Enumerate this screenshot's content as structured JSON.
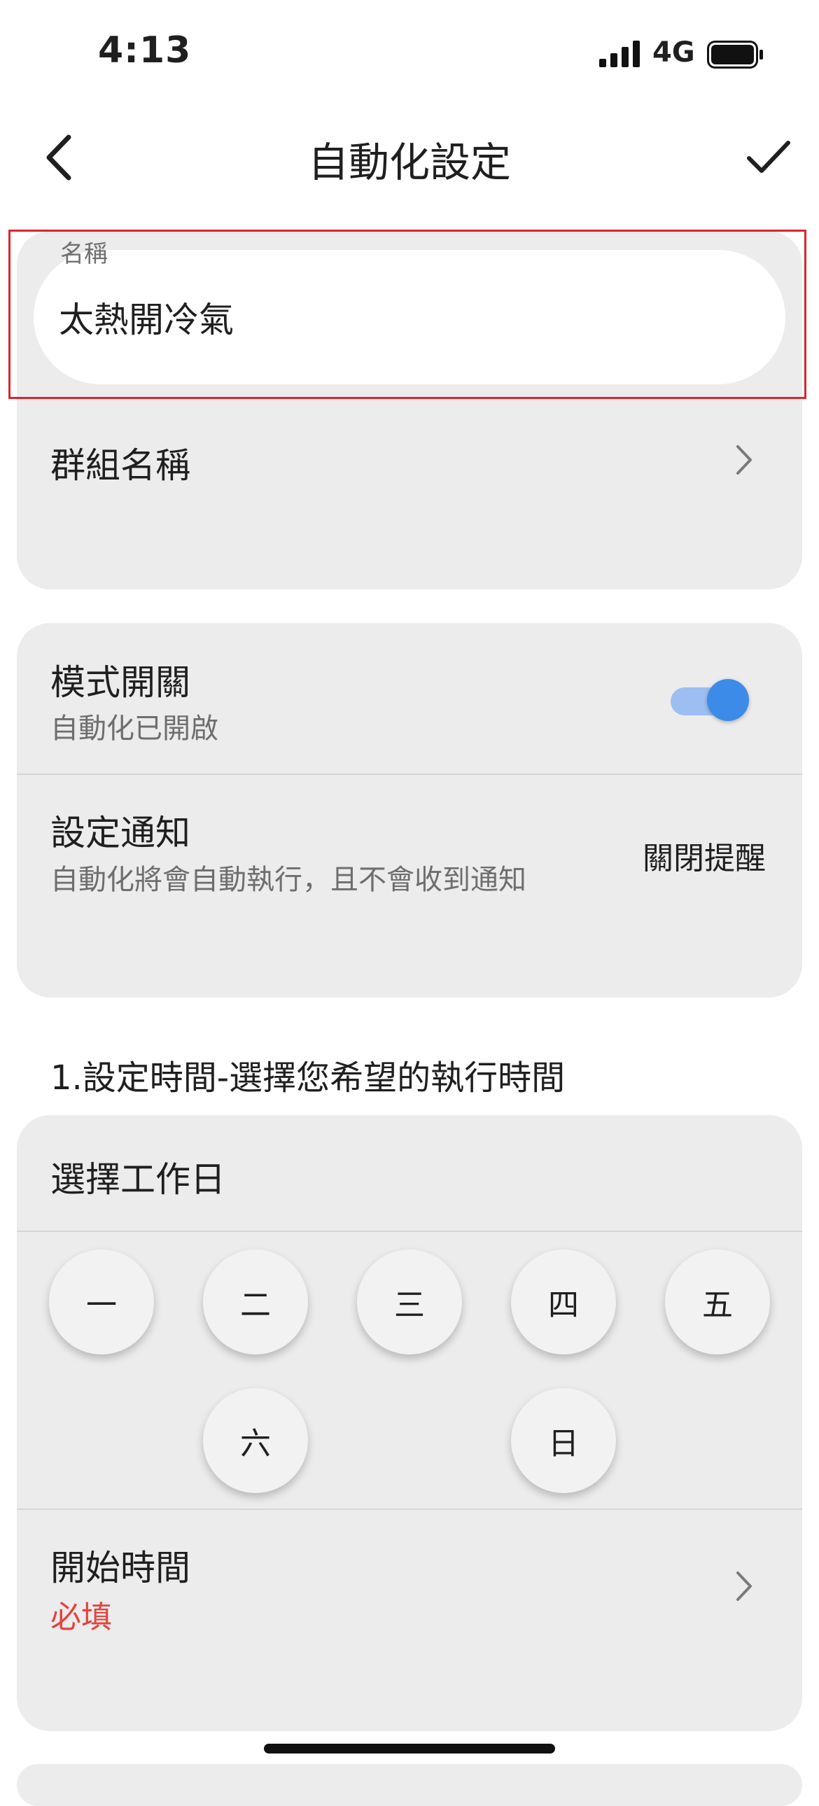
{
  "status_bar": {
    "time": "4:13",
    "network": "4G"
  },
  "header": {
    "title": "自動化設定"
  },
  "name": {
    "label": "名稱",
    "value": "太熱開冷氣"
  },
  "group": {
    "label": "群組名稱"
  },
  "mode_switch": {
    "label": "模式開關",
    "subtitle": "自動化已開啟",
    "enabled": true
  },
  "notification": {
    "label": "設定通知",
    "subtitle": "自動化將會自動執行，且不會收到通知",
    "value": "關閉提醒"
  },
  "schedule": {
    "heading": "1.設定時間-選擇您希望的執行時間",
    "workday_label": "選擇工作日",
    "days": [
      "一",
      "二",
      "三",
      "四",
      "五",
      "六",
      "日"
    ],
    "start_time_label": "開始時間",
    "start_time_required": "必填"
  },
  "colors": {
    "accent": "#3d8be9",
    "required": "#e5433c",
    "card": "#ececec",
    "highlight": "#d9262e"
  }
}
